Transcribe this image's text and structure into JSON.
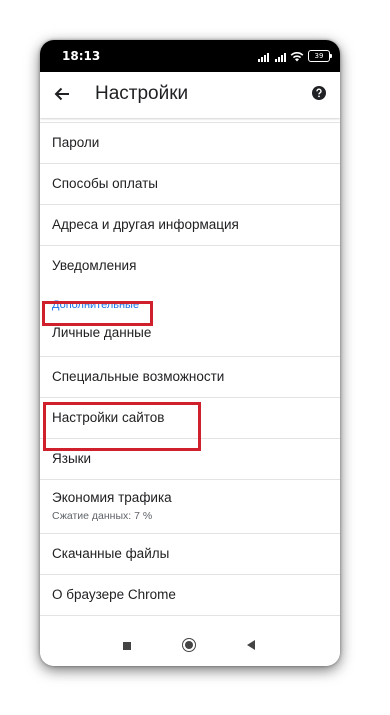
{
  "status": {
    "time": "18:13",
    "battery": "39"
  },
  "appbar": {
    "title": "Настройки"
  },
  "items_top": [
    {
      "label": "Пароли"
    },
    {
      "label": "Способы оплаты"
    },
    {
      "label": "Адреса и другая информация"
    },
    {
      "label": "Уведомления"
    }
  ],
  "section": {
    "label": "Дополнительные"
  },
  "items_advanced": [
    {
      "label": "Личные данные"
    },
    {
      "label": "Специальные возможности"
    },
    {
      "label": "Настройки сайтов"
    },
    {
      "label": "Языки"
    },
    {
      "label": "Экономия трафика",
      "sub": "Сжатие данных: 7 %"
    },
    {
      "label": "Скачанные файлы"
    },
    {
      "label": "О браузере Chrome"
    }
  ],
  "colors": {
    "accent": "#1a73e8",
    "highlight": "#d0202b",
    "statusbar": "#000000"
  },
  "icons": [
    "back-arrow-icon",
    "help-icon",
    "signal-icon",
    "wifi-icon",
    "battery-icon",
    "nav-recents-icon",
    "nav-home-icon",
    "nav-back-icon"
  ]
}
